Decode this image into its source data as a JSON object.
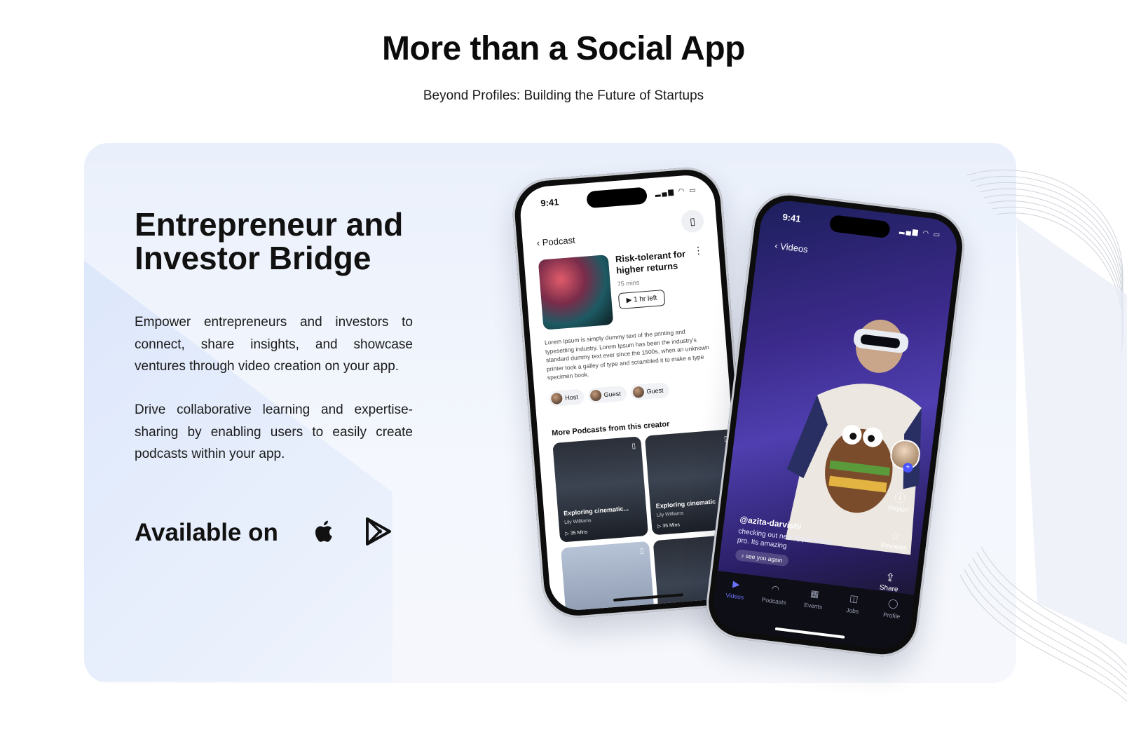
{
  "hero": {
    "heading": "More than a Social App",
    "subheading": "Beyond Profiles: Building the Future of Startups"
  },
  "feature": {
    "title_line1": "Entrepreneur and",
    "title_line2": "Investor Bridge",
    "paragraph1": "Empower entrepreneurs and investors to connect, share insights, and showcase ventures through video creation on your app.",
    "paragraph2": "Drive collaborative learning and expertise-sharing by enabling users to easily create podcasts within your app.",
    "available_label": "Available on",
    "stores": [
      "apple-app-store",
      "google-play-store"
    ]
  },
  "phone_podcast": {
    "status_time": "9:41",
    "nav_title": "Podcast",
    "podcast_title": "Risk-tolerant for higher returns",
    "duration": "75 mins",
    "time_left": "1 hr left",
    "description": "Lorem Ipsum is simply dummy text of the printing and typesetting industry. Lorem Ipsum has been the industry's standard dummy text ever since the 1500s, when an unknown printer took a galley of type and scrambled it to make a type specimen book.",
    "chips": [
      "Host",
      "Guest",
      "Guest"
    ],
    "more_title": "More Podcasts from this creator",
    "cards": [
      {
        "title": "Exploring cinematic...",
        "author": "Lily Williams",
        "duration": "35 Mins"
      },
      {
        "title": "Exploring cinematic",
        "author": "Lily Williams",
        "duration": "35 Mins"
      }
    ]
  },
  "phone_video": {
    "status_time": "9:41",
    "nav_title": "Videos",
    "side_actions": [
      "Report",
      "Reviews",
      "Share"
    ],
    "username": "@azita-darvishi",
    "caption": "checking out new apple vision pro. Its amazing",
    "music": "see you again",
    "tabs": [
      "Videos",
      "Podcasts",
      "Events",
      "Jobs",
      "Profile"
    ],
    "active_tab": "Videos"
  },
  "colors": {
    "accent": "#6b74ff",
    "card_bg": "#eef3fc",
    "text": "#111111"
  }
}
